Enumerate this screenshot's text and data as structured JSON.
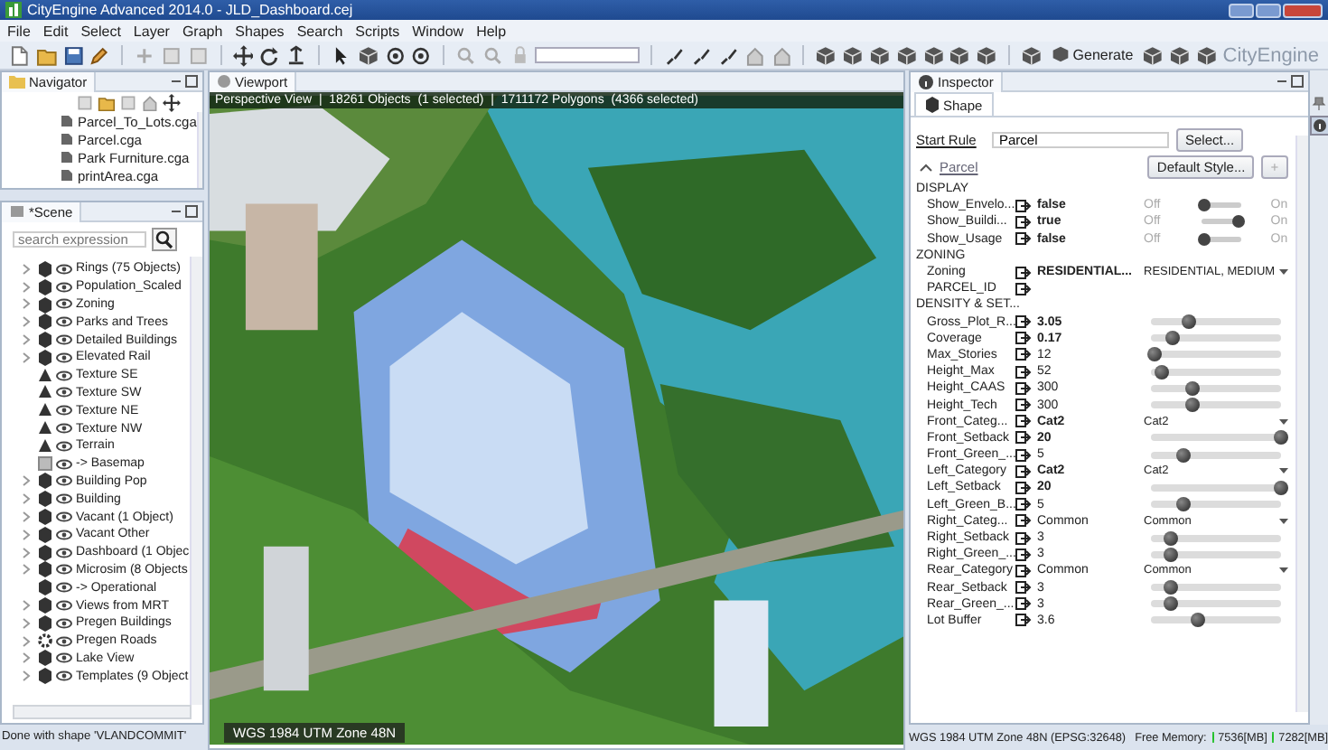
{
  "window": {
    "title": "CityEngine Advanced 2014.0 - JLD_Dashboard.cej"
  },
  "menu": [
    "File",
    "Edit",
    "Select",
    "Layer",
    "Graph",
    "Shapes",
    "Search",
    "Scripts",
    "Window",
    "Help"
  ],
  "toolbar": {
    "generate_label": "Generate",
    "brand": "CityEngine"
  },
  "navigator": {
    "tab": "Navigator",
    "files": [
      "Parcel_To_Lots.cga",
      "Parcel.cga",
      "Park Furniture.cga",
      "printArea.cga"
    ]
  },
  "scene": {
    "tab": "*Scene",
    "search": {
      "placeholder": "search expression"
    },
    "items": [
      {
        "name": "Rings (75 Objects)",
        "kind": "layer",
        "expandable": true
      },
      {
        "name": "Population_Scaled",
        "kind": "layer",
        "expandable": true
      },
      {
        "name": "Zoning",
        "kind": "layer",
        "expandable": true
      },
      {
        "name": "Parks and Trees",
        "kind": "layer",
        "expandable": true
      },
      {
        "name": "Detailed Buildings",
        "kind": "layer",
        "expandable": true
      },
      {
        "name": "Elevated Rail",
        "kind": "layer",
        "expandable": true
      },
      {
        "name": "Texture SE",
        "kind": "texture",
        "expandable": false
      },
      {
        "name": "Texture SW",
        "kind": "texture",
        "expandable": false
      },
      {
        "name": "Texture NE",
        "kind": "texture",
        "expandable": false
      },
      {
        "name": "Texture NW",
        "kind": "texture",
        "expandable": false
      },
      {
        "name": "Terrain",
        "kind": "texture",
        "expandable": false
      },
      {
        "name": "-> Basemap",
        "kind": "map",
        "expandable": false
      },
      {
        "name": "Building Pop",
        "kind": "layer",
        "expandable": true
      },
      {
        "name": "Building",
        "kind": "layer",
        "expandable": true
      },
      {
        "name": "Vacant (1 Object)",
        "kind": "layer",
        "expandable": true
      },
      {
        "name": "Vacant Other",
        "kind": "layer",
        "expandable": true
      },
      {
        "name": "Dashboard (1 Objec",
        "kind": "layer",
        "expandable": true
      },
      {
        "name": "Microsim (8 Objects",
        "kind": "layer",
        "expandable": true
      },
      {
        "name": "-> Operational",
        "kind": "layer",
        "expandable": false
      },
      {
        "name": "Views from MRT",
        "kind": "layer",
        "expandable": true
      },
      {
        "name": "Pregen Buildings",
        "kind": "layer",
        "expandable": true
      },
      {
        "name": "Pregen Roads",
        "kind": "network",
        "expandable": true
      },
      {
        "name": "Lake View",
        "kind": "layer",
        "expandable": true
      },
      {
        "name": "Templates (9 Object",
        "kind": "layer",
        "expandable": true
      }
    ]
  },
  "viewport": {
    "tab": "Viewport",
    "info": "Perspective View  |  18261 Objects  (1 selected)  |  1711172 Polygons  (4366 selected)",
    "footer": "WGS 1984 UTM Zone 48N"
  },
  "inspector": {
    "tab": "Inspector",
    "subtab": "Shape",
    "start_rule": {
      "label": "Start Rule",
      "value": "Parcel",
      "button": "Select..."
    },
    "section": {
      "title": "Parcel",
      "expanded": true,
      "style_button": "Default Style...",
      "add_button": "+"
    },
    "groups": [
      {
        "title": "DISPLAY",
        "attributes": [
          {
            "name": "Show_Envelo...",
            "value": "false",
            "bold": true,
            "kind": "toggle",
            "on": false,
            "off_label": "Off",
            "on_label": "On"
          },
          {
            "name": "Show_Buildi...",
            "value": "true",
            "bold": true,
            "kind": "toggle",
            "on": true,
            "off_label": "Off",
            "on_label": "On"
          },
          {
            "name": "Show_Usage",
            "value": "false",
            "bold": true,
            "kind": "toggle",
            "on": false,
            "off_label": "Off",
            "on_label": "On"
          }
        ]
      },
      {
        "title": "ZONING",
        "attributes": [
          {
            "name": "Zoning",
            "value": "RESIDENTIAL...",
            "bold": true,
            "kind": "dropdown",
            "choice": "RESIDENTIAL, MEDIUM"
          },
          {
            "name": "PARCEL_ID",
            "kind": "none"
          }
        ]
      },
      {
        "title": "DENSITY & SET...",
        "attributes": [
          {
            "name": "Gross_Plot_R...",
            "value": "3.05",
            "bold": true,
            "kind": "slider",
            "level": 0.3
          },
          {
            "name": "Coverage",
            "value": "0.17",
            "bold": true,
            "kind": "slider",
            "level": 0.17
          },
          {
            "name": "Max_Stories",
            "value": "12",
            "bold": false,
            "kind": "slider",
            "level": 0.03
          },
          {
            "name": "Height_Max",
            "value": "52",
            "bold": false,
            "kind": "slider",
            "level": 0.09
          },
          {
            "name": "Height_CAAS",
            "value": "300",
            "bold": false,
            "kind": "slider",
            "level": 0.32
          },
          {
            "name": "Height_Tech",
            "value": "300",
            "bold": false,
            "kind": "slider",
            "level": 0.32
          },
          {
            "name": "Front_Categ...",
            "value": "Cat2",
            "bold": true,
            "kind": "dropdown",
            "choice": "Cat2"
          },
          {
            "name": "Front_Setback",
            "value": "20",
            "bold": true,
            "kind": "slider",
            "level": 1
          },
          {
            "name": "Front_Green_...",
            "value": "5",
            "bold": false,
            "kind": "slider",
            "level": 0.25
          },
          {
            "name": "Left_Category",
            "value": "Cat2",
            "bold": true,
            "kind": "dropdown",
            "choice": "Cat2"
          },
          {
            "name": "Left_Setback",
            "value": "20",
            "bold": true,
            "kind": "slider",
            "level": 1
          },
          {
            "name": "Left_Green_B...",
            "value": "5",
            "bold": false,
            "kind": "slider",
            "level": 0.25
          },
          {
            "name": "Right_Categ...",
            "value": "Common",
            "bold": false,
            "kind": "dropdown",
            "choice": "Common"
          },
          {
            "name": "Right_Setback",
            "value": "3",
            "bold": false,
            "kind": "slider",
            "level": 0.16
          },
          {
            "name": "Right_Green_...",
            "value": "3",
            "bold": false,
            "kind": "slider",
            "level": 0.16
          },
          {
            "name": "Rear_Category",
            "value": "Common",
            "bold": false,
            "kind": "dropdown",
            "choice": "Common"
          },
          {
            "name": "Rear_Setback",
            "value": "3",
            "bold": false,
            "kind": "slider",
            "level": 0.16
          },
          {
            "name": "Rear_Green_...",
            "value": "3",
            "bold": false,
            "kind": "slider",
            "level": 0.16
          },
          {
            "name": "Lot Buffer",
            "value": "3.6",
            "bold": false,
            "kind": "slider",
            "level": 0.36
          }
        ]
      }
    ]
  },
  "status_bar": {
    "message": "Done with shape 'VLANDCOMMIT'",
    "crs": "WGS 1984 UTM Zone 48N (EPSG:32648)",
    "memory_label": "Free Memory:",
    "meters": [
      {
        "value": "7536[MB]",
        "color": "#22c02a"
      },
      {
        "value": "7282[MB]",
        "color": "#22c02a"
      }
    ]
  }
}
